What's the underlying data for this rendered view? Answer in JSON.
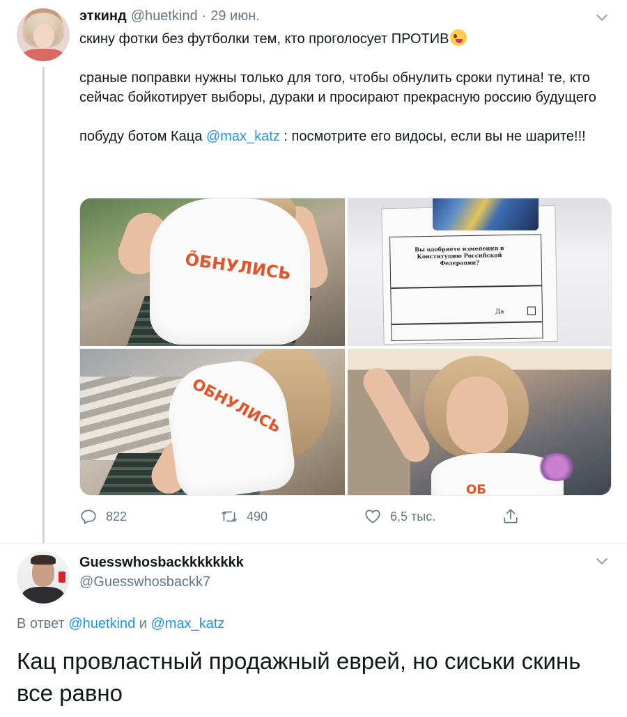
{
  "tweet": {
    "author_name": "эткинд",
    "author_handle": "@huetkind",
    "separator": "·",
    "date": "29 июн.",
    "text_1": "скину фотки без футболки тем, кто проголосует ПРОТИВ",
    "emoji_icon": "zany-face-emoji",
    "text_2": "сраные поправки нужны только для того, чтобы обнулить сроки путина! те, кто сейчас бойкотирует выборы, дураки и просирают прекрасную россию будущего",
    "text_3_before": "побуду ботом Каца ",
    "text_3_mention": "@max_katz",
    "text_3_after": " : посмотрите его видосы, если вы не шарите!!!",
    "photos": [
      {
        "name": "photo-girl-tshirt-bench",
        "shirt_text": "ÕБНУЛИСЬ"
      },
      {
        "name": "photo-ballot",
        "ballot_question": "Вы одобряете изменения в Конституцию Российской Федерации?",
        "ballot_yes": "Да"
      },
      {
        "name": "photo-girl-tshirt-crosswalk",
        "shirt_text": "ОБНУЛИСЬ"
      },
      {
        "name": "photo-girl-selfie",
        "shirt_text": "ОБ"
      }
    ],
    "actions": {
      "replies": "822",
      "retweets": "490",
      "likes": "6,5 тыс."
    }
  },
  "reply": {
    "author_name": "Guesswhosbackkkkkkkk",
    "author_handle": "@Guesswhosbackk7",
    "reply_prefix": "В ответ ",
    "reply_mention_1": "@huetkind",
    "reply_and": " и ",
    "reply_mention_2": "@max_katz",
    "text": "Кац провластный продажный еврей, но сиськи скинь все равно"
  },
  "colors": {
    "link": "#1b95e0",
    "secondary_text": "#657786",
    "primary_text": "#14171a",
    "thread_line": "#ccd6dd"
  }
}
